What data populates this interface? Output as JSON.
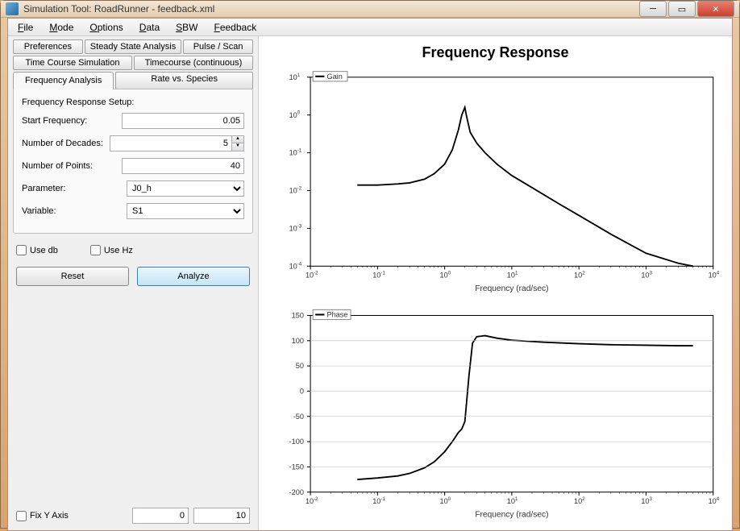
{
  "window": {
    "title": "Simulation Tool: RoadRunner - feedback.xml"
  },
  "menubar": [
    "File",
    "Mode",
    "Options",
    "Data",
    "SBW",
    "Feedback"
  ],
  "tabs": {
    "row1": [
      "Preferences",
      "Steady State Analysis",
      "Pulse / Scan"
    ],
    "row2": [
      "Time Course Simulation",
      "Timecourse (continuous)"
    ],
    "row3_active": "Frequency Analysis",
    "row3_other": "Rate vs. Species"
  },
  "setup": {
    "title": "Frequency Response Setup:",
    "start_freq_label": "Start Frequency:",
    "start_freq_value": "0.05",
    "decades_label": "Number of Decades:",
    "decades_value": "5",
    "points_label": "Number of Points:",
    "points_value": "40",
    "parameter_label": "Parameter:",
    "parameter_value": "J0_h",
    "variable_label": "Variable:",
    "variable_value": "S1"
  },
  "checks": {
    "use_db": "Use db",
    "use_hz": "Use Hz"
  },
  "buttons": {
    "reset": "Reset",
    "analyze": "Analyze"
  },
  "fixy": {
    "label": "Fix Y Axis",
    "min": "0",
    "max": "10"
  },
  "chart_title": "Frequency Response",
  "chart_data": [
    {
      "type": "line",
      "title": "Gain",
      "xlabel": "Frequency (rad/sec)",
      "x_scale": "log",
      "y_scale": "log",
      "xlim": [
        0.01,
        10000
      ],
      "ylim": [
        0.0001,
        10
      ],
      "x_ticks": [
        0.01,
        0.1,
        1,
        10,
        100,
        1000,
        10000
      ],
      "y_ticks": [
        0.0001,
        0.001,
        0.01,
        0.1,
        1,
        10
      ],
      "legend": "Gain",
      "x": [
        0.05,
        0.1,
        0.2,
        0.3,
        0.5,
        0.7,
        1.0,
        1.3,
        1.6,
        1.8,
        2.0,
        2.1,
        2.4,
        3.0,
        4.0,
        6.0,
        10,
        20,
        50,
        100,
        300,
        1000,
        3000,
        5000
      ],
      "y": [
        0.014,
        0.014,
        0.015,
        0.016,
        0.02,
        0.028,
        0.05,
        0.12,
        0.4,
        1.0,
        1.6,
        1.0,
        0.35,
        0.18,
        0.1,
        0.05,
        0.025,
        0.012,
        0.0045,
        0.0022,
        0.0007,
        0.00022,
        0.00012,
        0.0001
      ]
    },
    {
      "type": "line",
      "title": "Phase",
      "xlabel": "Frequency (rad/sec)",
      "x_scale": "log",
      "x_ticks": [
        0.01,
        0.1,
        1,
        10,
        100,
        1000,
        10000
      ],
      "xlim": [
        0.01,
        10000
      ],
      "ylim": [
        -200,
        150
      ],
      "y_ticks": [
        -200,
        -150,
        -100,
        -50,
        0,
        50,
        100,
        150
      ],
      "legend": "Phase",
      "x": [
        0.05,
        0.1,
        0.2,
        0.3,
        0.5,
        0.7,
        1.0,
        1.3,
        1.6,
        1.8,
        2.0,
        2.3,
        2.6,
        3.0,
        4.0,
        6.0,
        10,
        30,
        100,
        300,
        1000,
        3000,
        5000
      ],
      "y": [
        -175,
        -172,
        -168,
        -163,
        -152,
        -140,
        -120,
        -100,
        -82,
        -75,
        -60,
        30,
        95,
        108,
        110,
        105,
        101,
        97,
        94,
        92,
        91,
        90,
        90
      ]
    }
  ]
}
